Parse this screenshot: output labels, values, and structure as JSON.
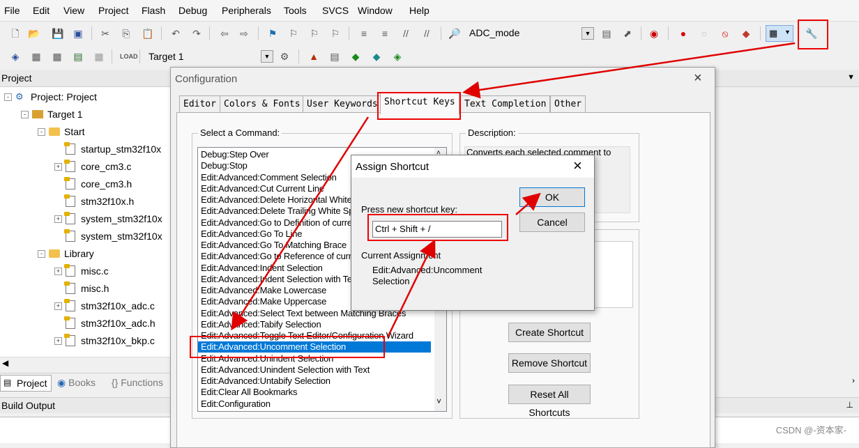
{
  "menu": [
    "File",
    "Edit",
    "View",
    "Project",
    "Flash",
    "Debug",
    "Peripherals",
    "Tools",
    "SVCS",
    "Window",
    "Help"
  ],
  "toolbar": {
    "target_combo": "ADC_mode",
    "build_target": "Target 1"
  },
  "project_panel": {
    "header": "Project",
    "tree": [
      {
        "label": "Project: Project",
        "level": 0,
        "exp": "-",
        "icon": "project-icon"
      },
      {
        "label": "Target 1",
        "level": 1,
        "exp": "-",
        "icon": "target-icon"
      },
      {
        "label": "Start",
        "level": 2,
        "exp": "-",
        "icon": "folder-icon"
      },
      {
        "label": "startup_stm32f10x",
        "level": 3,
        "exp": "",
        "icon": "file-icon"
      },
      {
        "label": "core_cm3.c",
        "level": 3,
        "exp": "+",
        "icon": "file-icon"
      },
      {
        "label": "core_cm3.h",
        "level": 3,
        "exp": "",
        "icon": "file-icon"
      },
      {
        "label": "stm32f10x.h",
        "level": 3,
        "exp": "",
        "icon": "file-icon"
      },
      {
        "label": "system_stm32f10x",
        "level": 3,
        "exp": "+",
        "icon": "file-icon"
      },
      {
        "label": "system_stm32f10x",
        "level": 3,
        "exp": "",
        "icon": "file-icon"
      },
      {
        "label": "Library",
        "level": 2,
        "exp": "-",
        "icon": "folder-icon"
      },
      {
        "label": "misc.c",
        "level": 3,
        "exp": "+",
        "icon": "file-icon"
      },
      {
        "label": "misc.h",
        "level": 3,
        "exp": "",
        "icon": "file-icon"
      },
      {
        "label": "stm32f10x_adc.c",
        "level": 3,
        "exp": "+",
        "icon": "file-icon"
      },
      {
        "label": "stm32f10x_adc.h",
        "level": 3,
        "exp": "",
        "icon": "file-icon"
      },
      {
        "label": "stm32f10x_bkp.c",
        "level": 3,
        "exp": "+",
        "icon": "file-icon"
      }
    ],
    "tabs": [
      "Project",
      "Books",
      "Functions"
    ]
  },
  "build_output": {
    "header": "Build Output"
  },
  "config_dialog": {
    "title": "Configuration",
    "tabs": [
      "Editor",
      "Colors & Fonts",
      "User Keywords",
      "Shortcut Keys",
      "Text Completion",
      "Other"
    ],
    "active_tab": "Shortcut Keys",
    "select_label": "Select a Command:",
    "commands": [
      "Debug:Step Over",
      "Debug:Stop",
      "Edit:Advanced:Comment Selection",
      "Edit:Advanced:Cut Current Line",
      "Edit:Advanced:Delete Horizontal Whitespace",
      "Edit:Advanced:Delete Trailing White Space",
      "Edit:Advanced:Go to Definition of current",
      "Edit:Advanced:Go To Line",
      "Edit:Advanced:Go To Matching Brace",
      "Edit:Advanced:Go to Reference of current",
      "Edit:Advanced:Indent Selection",
      "Edit:Advanced:Indent Selection with Text",
      "Edit:Advanced:Make Lowercase",
      "Edit:Advanced:Make Uppercase",
      "Edit:Advanced:Select Text between Matching Braces",
      "Edit:Advanced:Tabify Selection",
      "Edit:Advanced:Toggle Text Editor/Configuration Wizard",
      "Edit:Advanced:Uncomment Selection",
      "Edit:Advanced:Unindent Selection",
      "Edit:Advanced:Unindent Selection with Text",
      "Edit:Advanced:Untabify Selection",
      "Edit:Clear All Bookmarks",
      "Edit:Configuration"
    ],
    "selected_command": "Edit:Advanced:Uncomment Selection",
    "description_label": "Description:",
    "description_text": "Converts each selected comment to",
    "buttons": {
      "create": "Create Shortcut",
      "remove": "Remove Shortcut",
      "reset": "Reset All Shortcuts"
    }
  },
  "assign_dialog": {
    "title": "Assign Shortcut",
    "prompt": "Press new shortcut key:",
    "shortcut_value": "Ctrl + Shift + /",
    "current_label": "Current Assignment",
    "current_value": "Edit:Advanced:Uncomment Selection",
    "ok": "OK",
    "cancel": "Cancel"
  },
  "annotations": {
    "color": "#e00000"
  },
  "watermark": "CSDN @-资本家-"
}
